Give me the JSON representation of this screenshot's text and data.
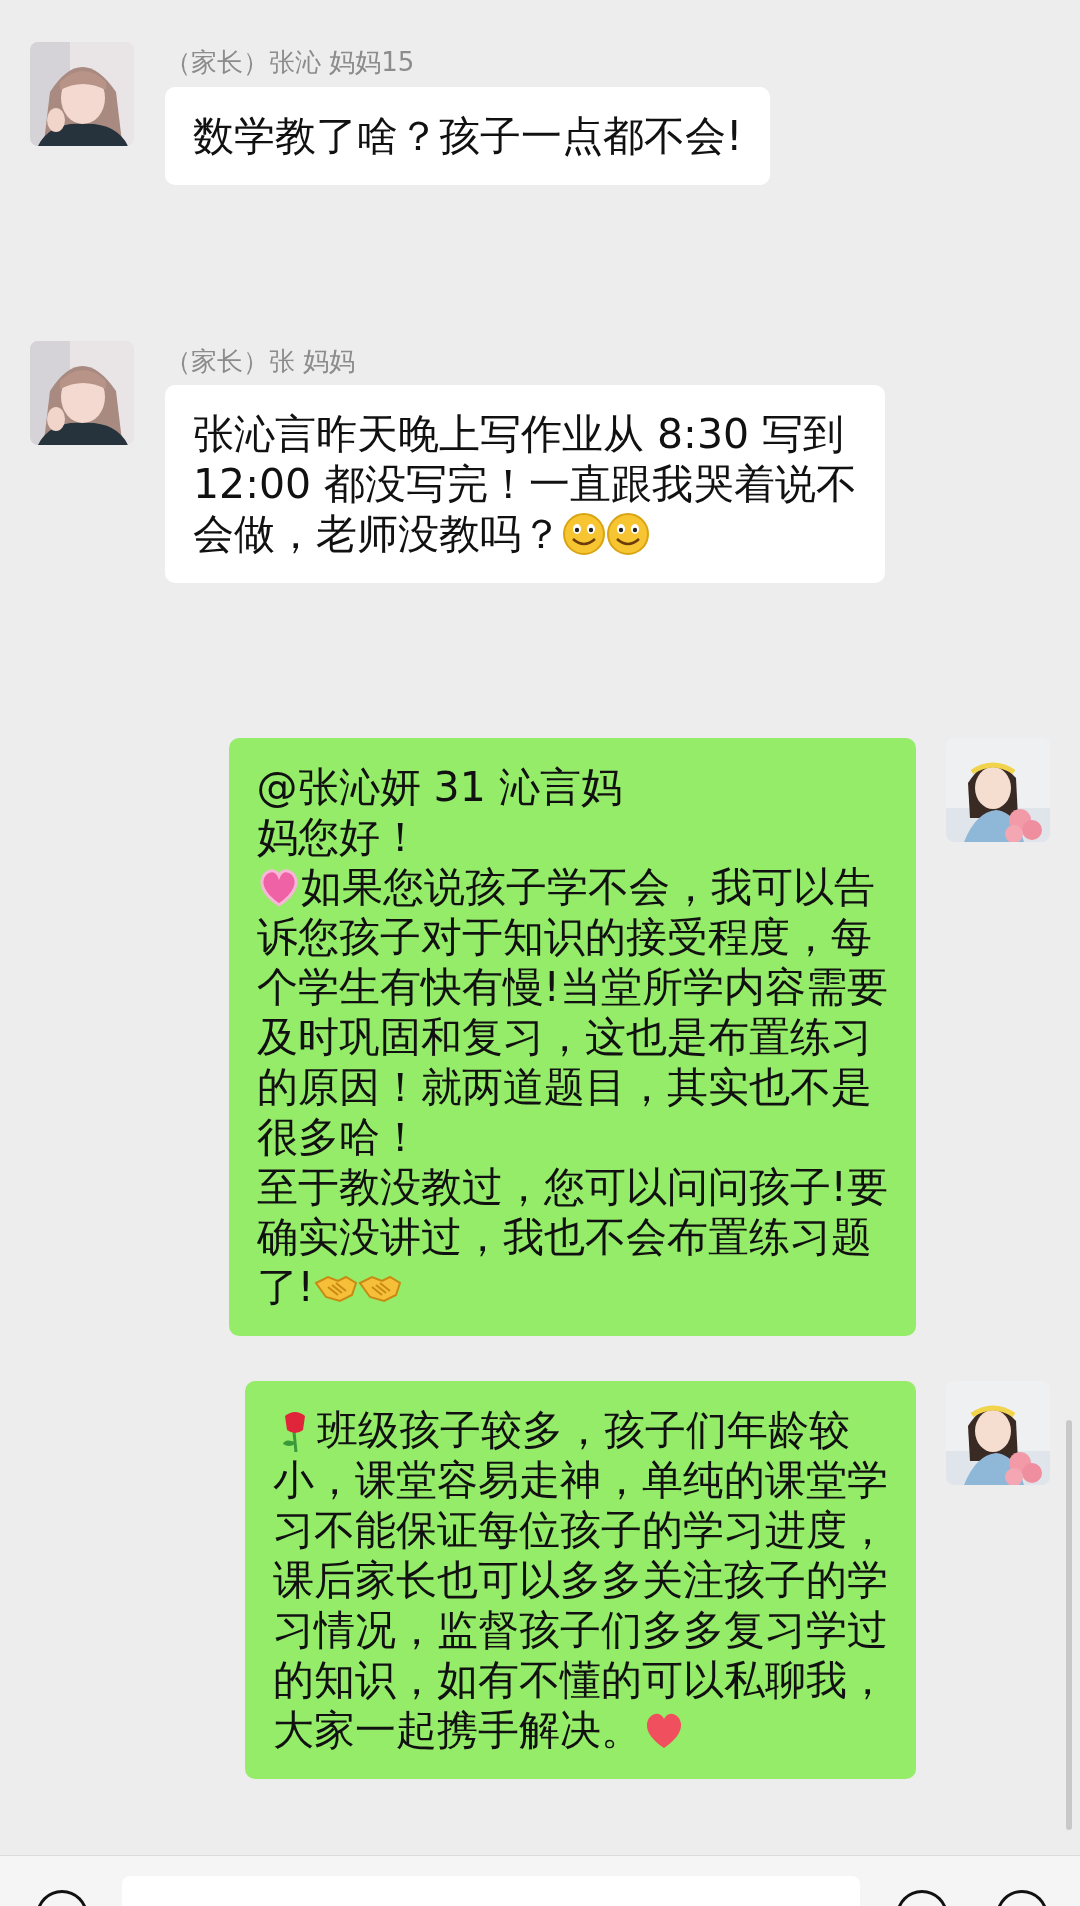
{
  "messages": [
    {
      "kind": "incoming",
      "name": "（家长）张沁 妈妈15",
      "lines": [
        [
          {
            "kind": "text",
            "text": "数学教了啥？孩子一点都不会!"
          }
        ]
      ]
    },
    {
      "kind": "incoming",
      "name": "（家长）张 妈妈",
      "lines": [
        [
          {
            "kind": "text",
            "text": "张沁言昨天晚上写作业从 8:30 写到"
          }
        ],
        [
          {
            "kind": "text",
            "text": "12:00 都没写完！一直跟我哭着说不"
          }
        ],
        [
          {
            "kind": "text",
            "text": "会做，老师没教吗？"
          },
          {
            "kind": "smiley"
          },
          {
            "kind": "smiley"
          }
        ]
      ]
    },
    {
      "kind": "outgoing",
      "lines": [
        [
          {
            "kind": "text",
            "text": "@张沁妍 31 沁言妈"
          }
        ],
        [
          {
            "kind": "text",
            "text": "妈您好！"
          }
        ],
        [
          {
            "kind": "pink_heart"
          },
          {
            "kind": "text",
            "text": "如果您说孩子学不会，我可以告"
          }
        ],
        [
          {
            "kind": "text",
            "text": "诉您孩子对于知识的接受程度，每"
          }
        ],
        [
          {
            "kind": "text",
            "text": "个学生有快有慢!当堂所学内容需要"
          }
        ],
        [
          {
            "kind": "text",
            "text": "及时巩固和复习，这也是布置练习"
          }
        ],
        [
          {
            "kind": "text",
            "text": "的原因！就两道题目，其实也不是"
          }
        ],
        [
          {
            "kind": "text",
            "text": "很多哈！"
          }
        ],
        [
          {
            "kind": "text",
            "text": "至于教没教过，您可以问问孩子!要"
          }
        ],
        [
          {
            "kind": "text",
            "text": "确实没讲过，我也不会布置练习题"
          }
        ],
        [
          {
            "kind": "text",
            "text": "了!"
          },
          {
            "kind": "handshake"
          },
          {
            "kind": "handshake"
          }
        ]
      ]
    },
    {
      "kind": "outgoing",
      "lines": [
        [
          {
            "kind": "rose"
          },
          {
            "kind": "text",
            "text": "班级孩子较多，孩子们年龄较"
          }
        ],
        [
          {
            "kind": "text",
            "text": "小，课堂容易走神，单纯的课堂学"
          }
        ],
        [
          {
            "kind": "text",
            "text": "习不能保证每位孩子的学习进度，"
          }
        ],
        [
          {
            "kind": "text",
            "text": "课后家长也可以多多关注孩子的学"
          }
        ],
        [
          {
            "kind": "text",
            "text": "习情况，监督孩子们多多复习学过"
          }
        ],
        [
          {
            "kind": "text",
            "text": "的知识，如有不懂的可以私聊我，"
          }
        ],
        [
          {
            "kind": "text",
            "text": "大家一起携手解决。"
          },
          {
            "kind": "red_heart"
          }
        ]
      ]
    }
  ]
}
